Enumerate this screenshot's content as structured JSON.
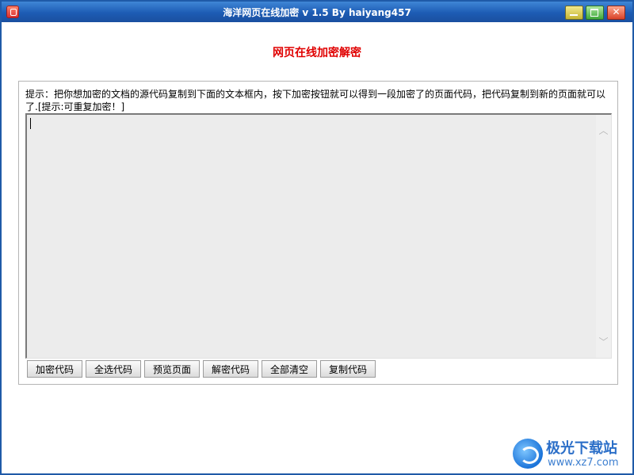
{
  "window": {
    "title": "海洋网页在线加密 v 1.5  By haiyang457",
    "controls": {
      "minimize": "",
      "maximize": "",
      "close": "✕"
    }
  },
  "main": {
    "heading": "网页在线加密解密",
    "hint": "提示：把你想加密的文档的源代码复制到下面的文本框内，按下加密按钮就可以得到一段加密了的页面代码，把代码复制到新的页面就可以了.[提示:可重复加密！]",
    "editor": {
      "value": ""
    },
    "buttons": [
      "加密代码",
      "全选代码",
      "预览页面",
      "解密代码",
      "全部清空",
      "复制代码"
    ]
  },
  "watermark": {
    "name": "极光下载站",
    "url": "www.xz7.com"
  },
  "colors": {
    "title_bar": "#1d5cb4",
    "heading": "#e00000"
  }
}
